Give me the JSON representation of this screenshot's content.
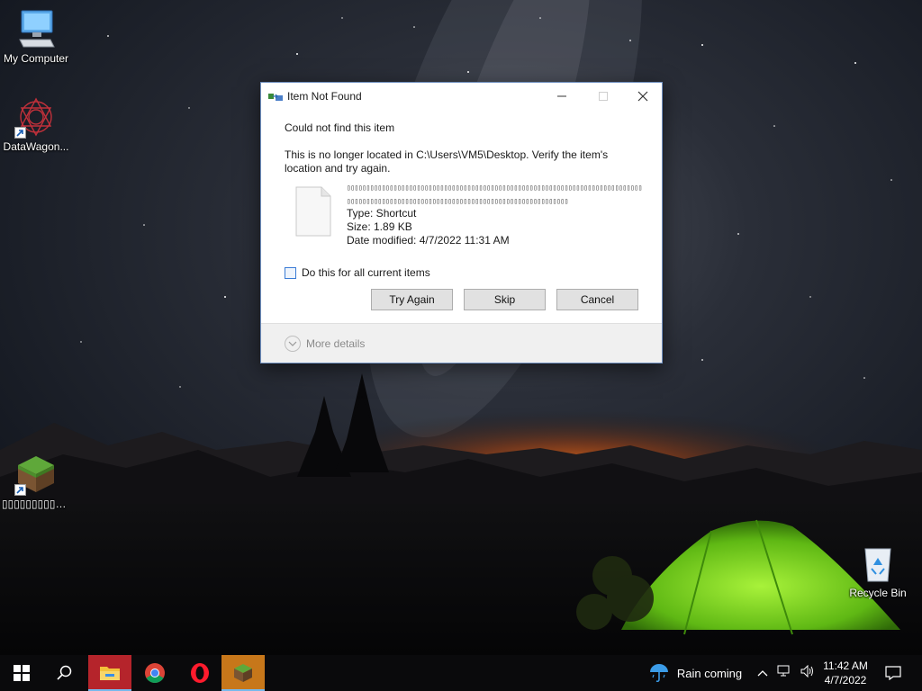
{
  "desktop": {
    "icons": [
      {
        "label": "My Computer"
      },
      {
        "label": "DataWagon..."
      },
      {
        "label": "▯▯▯▯▯▯▯▯▯▯▯▯..."
      },
      {
        "label": "Recycle Bin"
      }
    ]
  },
  "dialog": {
    "title": "Item Not Found",
    "heading": "Could not find this item",
    "message": "This is no longer located in C:\\Users\\VM5\\Desktop. Verify the item's location and try again.",
    "file": {
      "name": "▯▯▯▯▯▯▯▯▯▯▯▯▯▯▯▯▯▯▯▯▯▯▯▯▯▯▯▯▯▯▯▯▯▯▯▯▯▯▯▯▯▯▯▯▯▯▯▯▯▯▯▯▯▯▯▯▯▯▯▯▯▯▯▯▯▯▯▯▯▯▯▯▯▯▯▯▯▯▯▯▯▯▯▯▯▯▯▯▯▯▯▯▯▯▯▯▯▯▯▯▯▯▯▯▯▯▯▯▯▯▯▯▯▯▯▯▯▯▯▯▯▯▯▯▯▯▯▯▯▯▯▯▯",
      "type": "Type: Shortcut",
      "size": "Size: 1.89 KB",
      "date_modified": "Date modified: 4/7/2022 11:31 AM"
    },
    "checkbox_label": "Do this for all current items",
    "checkbox_checked": false,
    "buttons": {
      "try_again": "Try Again",
      "skip": "Skip",
      "cancel": "Cancel"
    },
    "more_details": "More details"
  },
  "taskbar": {
    "apps": [
      "file-explorer",
      "chrome",
      "opera",
      "minecraft"
    ],
    "weather": "Rain coming",
    "clock_time": "11:42 AM",
    "clock_date": "4/7/2022"
  },
  "colors": {
    "accent": "#0078d7",
    "taskbar": "#0a0a0c",
    "tent_green": "#7fdc1f"
  }
}
